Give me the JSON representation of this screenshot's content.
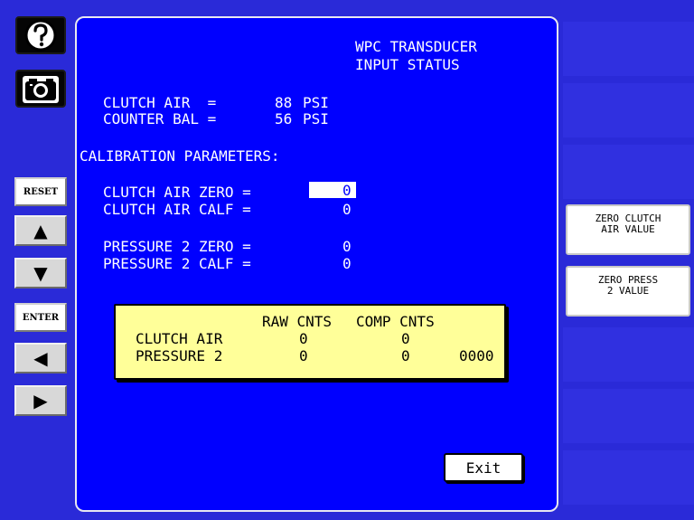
{
  "left_bar": {
    "help_icon": "question-circle-icon",
    "camera_icon": "camera-icon",
    "reset_label": "RESET",
    "enter_label": "ENTER",
    "up_arrow_glyph": "▲",
    "down_arrow_glyph": "▼",
    "left_arrow_glyph": "◀",
    "right_arrow_glyph": "▶"
  },
  "header": {
    "title_line1": "WPC TRANSDUCER",
    "title_line2": "INPUT STATUS"
  },
  "readings": [
    {
      "label": "CLUTCH AIR  =",
      "value": "88",
      "unit": "PSI"
    },
    {
      "label": "COUNTER BAL =",
      "value": "56",
      "unit": "PSI"
    }
  ],
  "calibration": {
    "heading": "CALIBRATION PARAMETERS:",
    "clutch_air_zero_label": "CLUTCH AIR ZERO =",
    "clutch_air_zero_value": "0",
    "clutch_air_calf_label": "CLUTCH AIR CALF =",
    "clutch_air_calf_value": "0",
    "pressure2_zero_label": "PRESSURE 2 ZERO =",
    "pressure2_zero_value": "0",
    "pressure2_calf_label": "PRESSURE 2 CALF =",
    "pressure2_calf_value": "0"
  },
  "status_table": {
    "col_raw": "RAW CNTS",
    "col_comp": "COMP CNTS",
    "row1_label": "CLUTCH AIR",
    "row1_raw": "0",
    "row1_comp": "0",
    "row2_label": "PRESSURE 2",
    "row2_raw": "0",
    "row2_comp": "0",
    "row2_extra": "0000"
  },
  "softkeys": {
    "zero_clutch_line1": "ZERO CLUTCH",
    "zero_clutch_line2": "AIR VALUE",
    "zero_press_line1": "ZERO PRESS",
    "zero_press_line2": "2 VALUE"
  },
  "exit_label": "Exit",
  "colors": {
    "background": "#2a2ad8",
    "panel": "#0000ff",
    "status_box": "#ffff99",
    "text": "#ffffff"
  }
}
